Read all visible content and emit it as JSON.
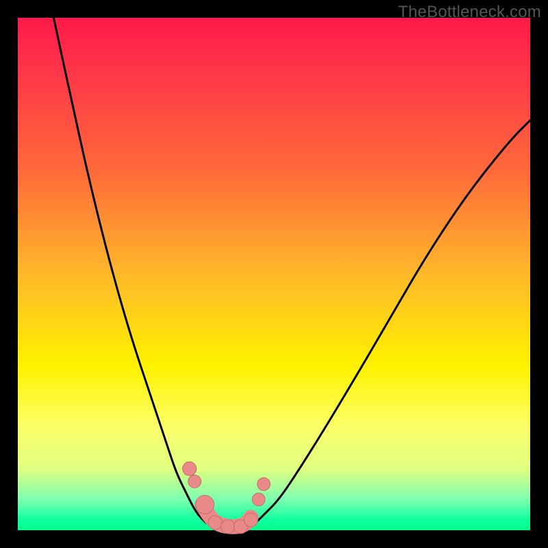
{
  "watermark": {
    "text": "TheBottleneck.com"
  },
  "chart_data": {
    "type": "line",
    "title": "",
    "xlabel": "",
    "ylabel": "",
    "xlim": [
      0,
      100
    ],
    "ylim": [
      0,
      100
    ],
    "series": [
      {
        "name": "left-curve",
        "x": [
          7,
          10,
          14,
          18,
          22,
          26,
          29,
          31,
          33,
          34.5,
          36,
          38,
          40
        ],
        "y": [
          100,
          86,
          68,
          52,
          38,
          26,
          17,
          11,
          7,
          4,
          2,
          0.5,
          0
        ]
      },
      {
        "name": "right-curve",
        "x": [
          44,
          46,
          48,
          51,
          55,
          60,
          66,
          73,
          80,
          88,
          96,
          100
        ],
        "y": [
          0,
          1,
          3,
          6,
          12,
          20,
          30,
          42,
          54,
          66,
          76,
          80
        ]
      }
    ],
    "markers": [
      {
        "name": "left-top",
        "cx": 33.5,
        "cy": 12.0,
        "r": 1.5
      },
      {
        "name": "left-mid",
        "cx": 34.5,
        "cy": 9.5,
        "r": 1.4
      },
      {
        "name": "left-end",
        "cx": 36.5,
        "cy": 5.0,
        "r": 2.0
      },
      {
        "name": "bottom-1",
        "cx": 38.5,
        "cy": 1.5,
        "r": 1.5
      },
      {
        "name": "bottom-2",
        "cx": 41.0,
        "cy": 0.7,
        "r": 1.5
      },
      {
        "name": "bottom-3",
        "cx": 43.5,
        "cy": 0.7,
        "r": 1.5
      },
      {
        "name": "right-start",
        "cx": 45.5,
        "cy": 2.0,
        "r": 1.5
      },
      {
        "name": "right-mid",
        "cx": 47.0,
        "cy": 6.0,
        "r": 1.4
      },
      {
        "name": "right-top",
        "cx": 48.0,
        "cy": 9.0,
        "r": 1.4
      }
    ],
    "connector": {
      "x": [
        36.0,
        37.5,
        39.0,
        41.0,
        43.0,
        44.5,
        45.5
      ],
      "y": [
        5.0,
        2.5,
        1.2,
        0.7,
        0.7,
        1.2,
        2.5
      ]
    },
    "colors": {
      "curve": "#000000",
      "marker_fill": "#e98a8a",
      "marker_stroke": "#c96a6a",
      "connector": "#e98a8a"
    }
  }
}
